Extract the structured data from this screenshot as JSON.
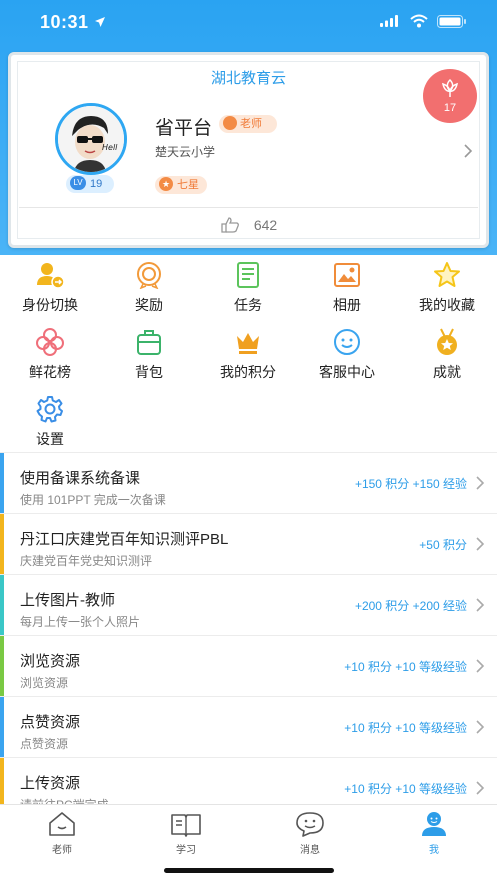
{
  "status_bar": {
    "time": "10:31"
  },
  "card": {
    "title": "湖北教育云",
    "user_name": "省平台",
    "role": "老师",
    "school": "楚天云小学",
    "level": "19",
    "level_prefix": "LV",
    "star_level": "七星",
    "flowers": "17",
    "likes": "642",
    "avatar_text": "Hell"
  },
  "menu": [
    {
      "label": "身份切换",
      "icon": "switch-identity-icon",
      "color": "#f2b51d"
    },
    {
      "label": "奖励",
      "icon": "reward-icon",
      "color": "#f29a3a"
    },
    {
      "label": "任务",
      "icon": "task-icon",
      "color": "#5cc45c"
    },
    {
      "label": "相册",
      "icon": "album-icon",
      "color": "#f08c3a"
    },
    {
      "label": "我的收藏",
      "icon": "star-icon",
      "color": "#f5c518"
    },
    {
      "label": "鲜花榜",
      "icon": "flower-icon",
      "color": "#ef6f7a"
    },
    {
      "label": "背包",
      "icon": "backpack-icon",
      "color": "#3bb36a"
    },
    {
      "label": "我的积分",
      "icon": "crown-icon",
      "color": "#f0a020"
    },
    {
      "label": "客服中心",
      "icon": "customer-service-icon",
      "color": "#3aa4ef"
    },
    {
      "label": "成就",
      "icon": "medal-icon",
      "color": "#f0b020"
    },
    {
      "label": "设置",
      "icon": "gear-icon",
      "color": "#3a8ee6"
    }
  ],
  "tasks": [
    {
      "title": "使用备课系统备课",
      "desc": "使用 101PPT 完成一次备课",
      "reward": "+150 积分 +150 经验",
      "bar_color": "#3aa4ef"
    },
    {
      "title": "丹江口庆建党百年知识测评PBL",
      "desc": "庆建党百年党史知识测评",
      "reward": "+50 积分",
      "bar_color": "#f2b51d"
    },
    {
      "title": "上传图片-教师",
      "desc": "每月上传一张个人照片",
      "reward": "+200 积分 +200 经验",
      "bar_color": "#3ac7c7"
    },
    {
      "title": "浏览资源",
      "desc": "浏览资源",
      "reward": "+10 积分 +10 等级经验",
      "bar_color": "#7ac943"
    },
    {
      "title": "点赞资源",
      "desc": "点赞资源",
      "reward": "+10 积分 +10 等级经验",
      "bar_color": "#3aa4ef"
    },
    {
      "title": "上传资源",
      "desc": "请前往PC端完成",
      "reward": "+10 积分 +10 等级经验",
      "bar_color": "#f2b51d"
    }
  ],
  "tabbar": [
    {
      "label": "老师",
      "icon": "home-icon",
      "active": false
    },
    {
      "label": "学习",
      "icon": "book-icon",
      "active": false
    },
    {
      "label": "消息",
      "icon": "message-icon",
      "active": false
    },
    {
      "label": "我",
      "icon": "person-icon",
      "active": true
    }
  ],
  "colors": {
    "accent": "#2d9de8",
    "header": "#2aa3f2",
    "badge": "#f26f6f"
  }
}
